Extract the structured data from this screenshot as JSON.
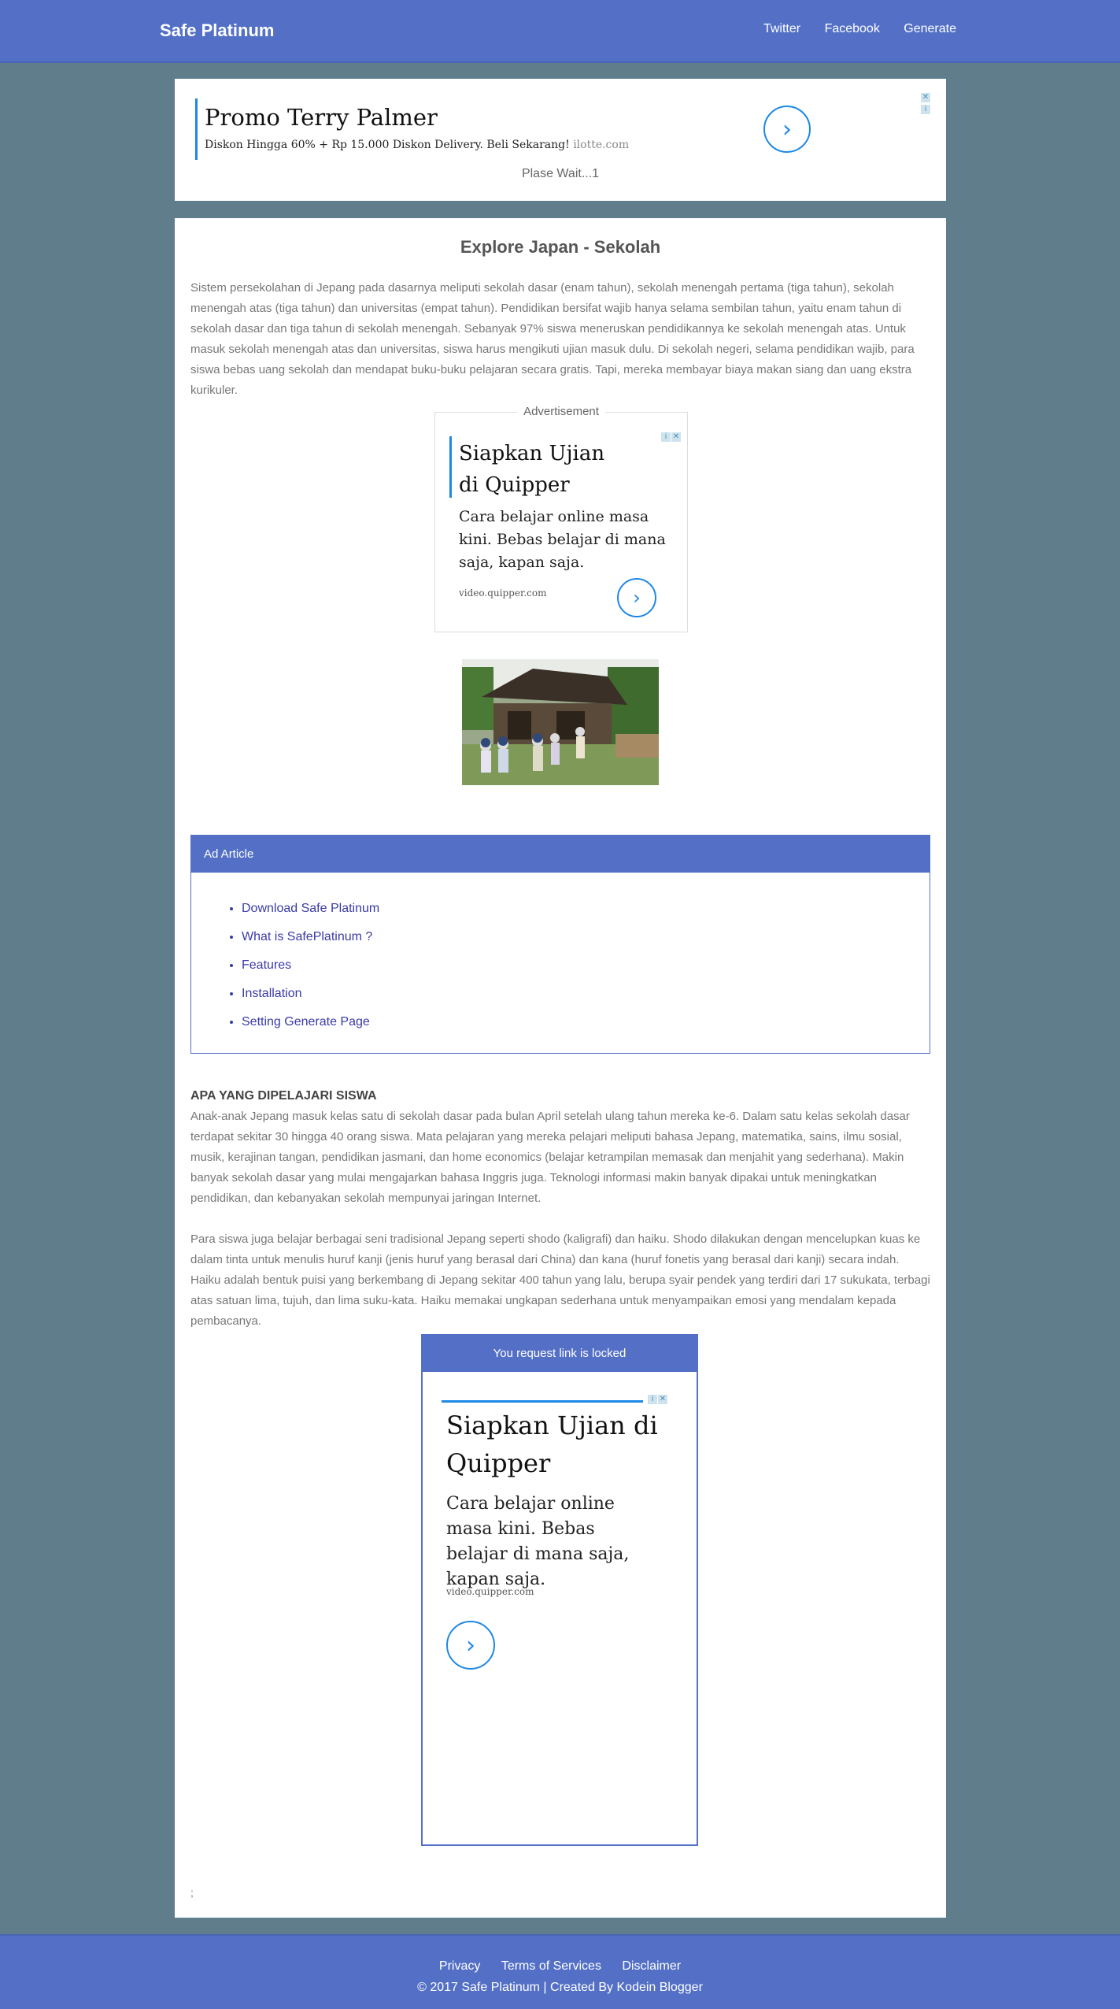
{
  "nav": {
    "brand": "Safe Platinum",
    "links": [
      "Twitter",
      "Facebook",
      "Generate"
    ]
  },
  "top_ad": {
    "title": "Promo Terry Palmer",
    "desc": "Diskon Hingga 60% + Rp 15.000 Diskon Delivery. Beli Sekarang!",
    "domain": "ilotte.com",
    "wait_text": "Plase Wait...1",
    "arrow_icon": "›"
  },
  "article": {
    "title": "Explore Japan - Sekolah",
    "intro": "Sistem persekolahan di Jepang pada dasarnya meliputi sekolah dasar (enam tahun), sekolah menengah pertama (tiga tahun), sekolah menengah atas (tiga tahun) dan universitas (empat tahun). Pendidikan bersifat wajib hanya selama sembilan tahun, yaitu enam tahun di sekolah dasar dan tiga tahun di sekolah menengah. Sebanyak 97% siswa meneruskan pendidikannya ke sekolah menengah atas. Untuk masuk sekolah menengah atas dan universitas, siswa harus mengikuti ujian masuk dulu. Di sekolah negeri, selama pendidikan wajib, para siswa bebas uang sekolah dan mendapat buku-buku pelajaran secara gratis. Tapi, mereka membayar biaya makan siang dan uang ekstra kurikuler.",
    "ad_label": "Advertisement",
    "section_heading": "APA YANG DIPELAJARI SISWA",
    "p1": "Anak-anak Jepang masuk kelas satu di sekolah dasar pada bulan April setelah ulang tahun mereka ke-6. Dalam satu kelas sekolah dasar terdapat sekitar 30 hingga 40 orang siswa. Mata pelajaran yang mereka pelajari meliputi bahasa Jepang, matematika, sains, ilmu sosial, musik, kerajinan tangan, pendidikan jasmani, dan home economics (belajar ketrampilan memasak dan menjahit yang sederhana). Makin banyak sekolah dasar yang mulai mengajarkan bahasa Inggris juga. Teknologi informasi makin banyak dipakai untuk meningkatkan pendidikan, dan kebanyakan sekolah mempunyai jaringan Internet.",
    "p2": "Para siswa juga belajar berbagai seni tradisional Jepang seperti shodo (kaligrafi) dan haiku. Shodo dilakukan dengan mencelupkan kuas ke dalam tinta untuk menulis huruf kanji (jenis huruf yang berasal dari China) dan kana (huruf fonetis yang berasal dari kanji) secara indah. Haiku adalah bentuk puisi yang berkembang di Jepang sekitar 400 tahun yang lalu, berupa syair pendek yang terdiri dari 17 sukukata, terbagi atas satuan lima, tujuh, dan lima suku-kata. Haiku memakai ungkapan sederhana untuk menyampaikan emosi yang mendalam kepada pembacanya.",
    "trailing": ";"
  },
  "square_ad": {
    "title": "Siapkan Ujian di Quipper",
    "body": "Cara belajar online masa kini. Bebas belajar di mana saja, kapan saja.",
    "domain": "video.quipper.com",
    "arrow_icon": "›"
  },
  "ad_article": {
    "header": "Ad Article",
    "items": [
      "Download Safe Platinum",
      "What is SafePlatinum ?",
      "Features",
      "Installation",
      "Setting Generate Page"
    ]
  },
  "locked": {
    "header": "You request link is locked",
    "title": "Siapkan Ujian di Quipper",
    "body": "Cara belajar online masa kini. Bebas belajar di mana saja, kapan saja.",
    "domain": "video.quipper.com",
    "arrow_icon": "›"
  },
  "footer": {
    "links": [
      "Privacy",
      "Terms of Services",
      "Disclaimer"
    ],
    "copyright": "© 2017 Safe Platinum | Created By Kodein Blogger"
  },
  "colors": {
    "primary": "#5470c6",
    "background": "#607d8b",
    "ad_accent": "#1e88e5",
    "link": "#3a3aa8"
  }
}
